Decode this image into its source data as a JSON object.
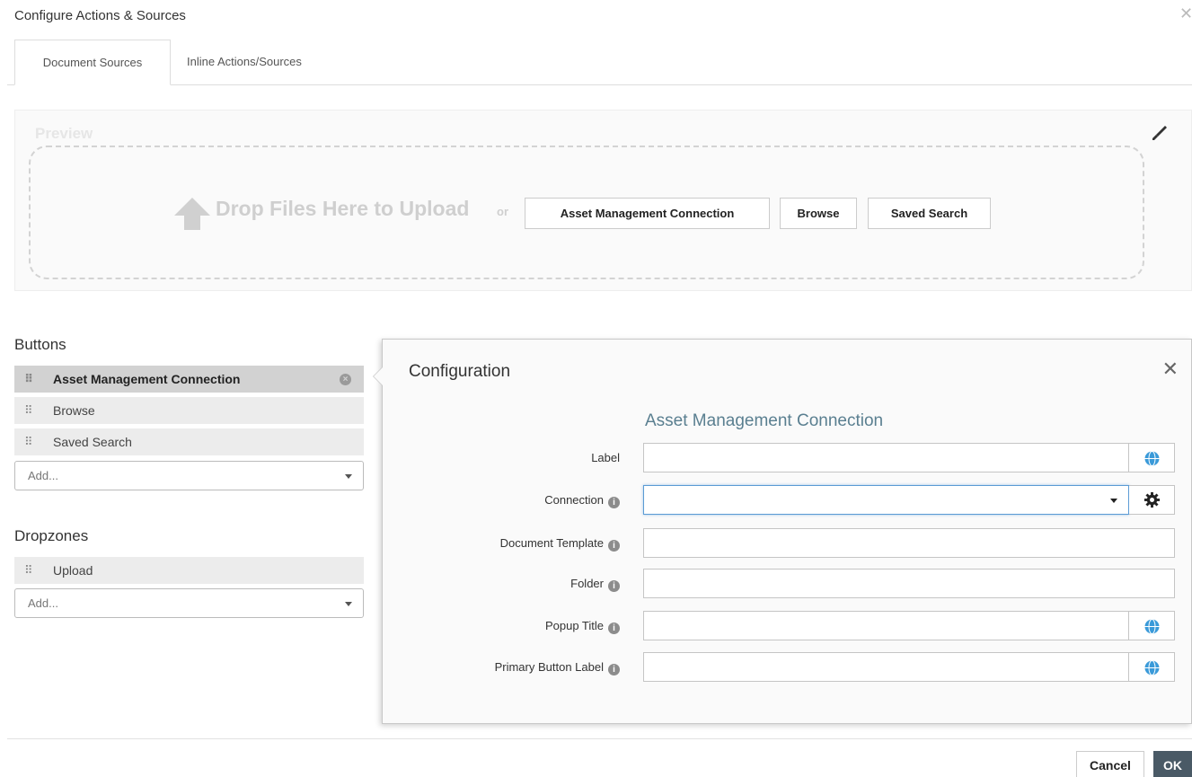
{
  "dialog": {
    "title": "Configure Actions & Sources",
    "close_symbol": "✕"
  },
  "tabs": [
    {
      "label": "Document Sources"
    },
    {
      "label": "Inline Actions/Sources"
    }
  ],
  "preview": {
    "title": "Preview",
    "drop_text": "Drop Files Here to Upload",
    "or_text": "or",
    "buttons": [
      "Asset Management Connection",
      "Browse",
      "Saved Search"
    ],
    "edit_icon": "pencil-icon"
  },
  "buttons_section": {
    "heading": "Buttons",
    "items": [
      {
        "label": "Asset Management Connection",
        "selected": true
      },
      {
        "label": "Browse",
        "selected": false
      },
      {
        "label": "Saved Search",
        "selected": false
      }
    ],
    "add_placeholder": "Add..."
  },
  "dropzones_section": {
    "heading": "Dropzones",
    "items": [
      {
        "label": "Upload"
      }
    ],
    "add_placeholder": "Add..."
  },
  "configuration": {
    "title": "Configuration",
    "subtitle": "Asset Management Connection",
    "close_symbol": "✕",
    "fields": {
      "label": {
        "label": "Label",
        "value": ""
      },
      "connection": {
        "label": "Connection",
        "value": ""
      },
      "document_template": {
        "label": "Document Template",
        "value": ""
      },
      "folder": {
        "label": "Folder",
        "value": ""
      },
      "popup_title": {
        "label": "Popup Title",
        "value": ""
      },
      "primary_button_label": {
        "label": "Primary Button Label",
        "value": ""
      }
    },
    "accent_color": "#3a9ad9",
    "subtitle_color": "#5a7f90"
  },
  "footer": {
    "cancel": "Cancel",
    "ok": "OK"
  },
  "icons": [
    "drag-handle-icon",
    "remove-circle-icon",
    "chevron-down-icon",
    "info-icon",
    "globe-icon",
    "gear-icon",
    "upload-arrow-icon",
    "pencil-icon",
    "close-icon"
  ]
}
